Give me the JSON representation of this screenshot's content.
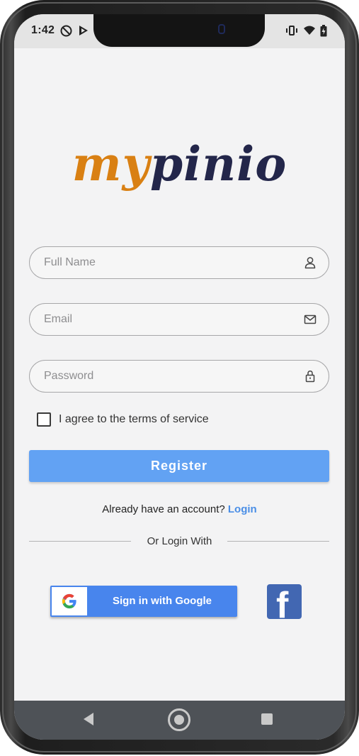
{
  "status_bar": {
    "time": "1:42",
    "left_icons": [
      "do-not-disturb-icon",
      "play-store-icon"
    ],
    "right_icons": [
      "vibrate-icon",
      "wifi-icon",
      "battery-icon"
    ]
  },
  "logo": {
    "part1": "my",
    "part2": "pinio"
  },
  "form": {
    "full_name": {
      "placeholder": "Full Name",
      "value": "",
      "icon": "person-icon"
    },
    "email": {
      "placeholder": "Email",
      "value": "",
      "icon": "mail-icon"
    },
    "password": {
      "placeholder": "Password",
      "value": "",
      "icon": "lock-icon"
    },
    "terms_label": "I agree to the terms of service",
    "terms_checked": false,
    "register_label": "Register"
  },
  "account": {
    "prompt": "Already have an account?",
    "login_link": "Login"
  },
  "divider": {
    "text": "Or Login With"
  },
  "social": {
    "google_label": "Sign in with Google",
    "facebook_letter": "f"
  },
  "colors": {
    "accent_blue": "#62a2f3",
    "link_blue": "#4a8ee6",
    "logo_orange": "#d98013",
    "logo_navy": "#23264a",
    "google_blue": "#4885ed",
    "facebook_blue": "#4267b2"
  }
}
